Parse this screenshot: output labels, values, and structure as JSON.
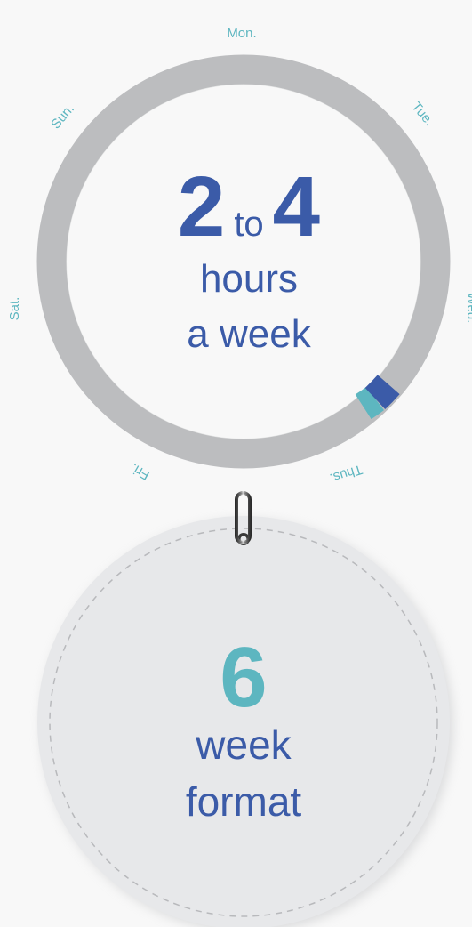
{
  "days": {
    "mon": "Mon.",
    "tue": "Tue.",
    "wed": "Wed.",
    "thus": "Thus.",
    "fri": "Fri.",
    "sat": "Sat.",
    "sun": "Sun."
  },
  "commitment": {
    "min": "2",
    "connector": "to",
    "max": "4",
    "unit": "hours",
    "period": "a week"
  },
  "format": {
    "number": "6",
    "line1": "week",
    "line2": "format"
  },
  "colors": {
    "background": "#f8f8f8",
    "ring": "#bcbdbf",
    "navy": "#3b5ba8",
    "teal": "#5db6c0",
    "tag_fill": "#e7e8ea",
    "stitch": "#b8b9bc"
  },
  "ring_progress": {
    "teal_segment_fraction": 0.03,
    "navy_segment_fraction": 0.02
  }
}
